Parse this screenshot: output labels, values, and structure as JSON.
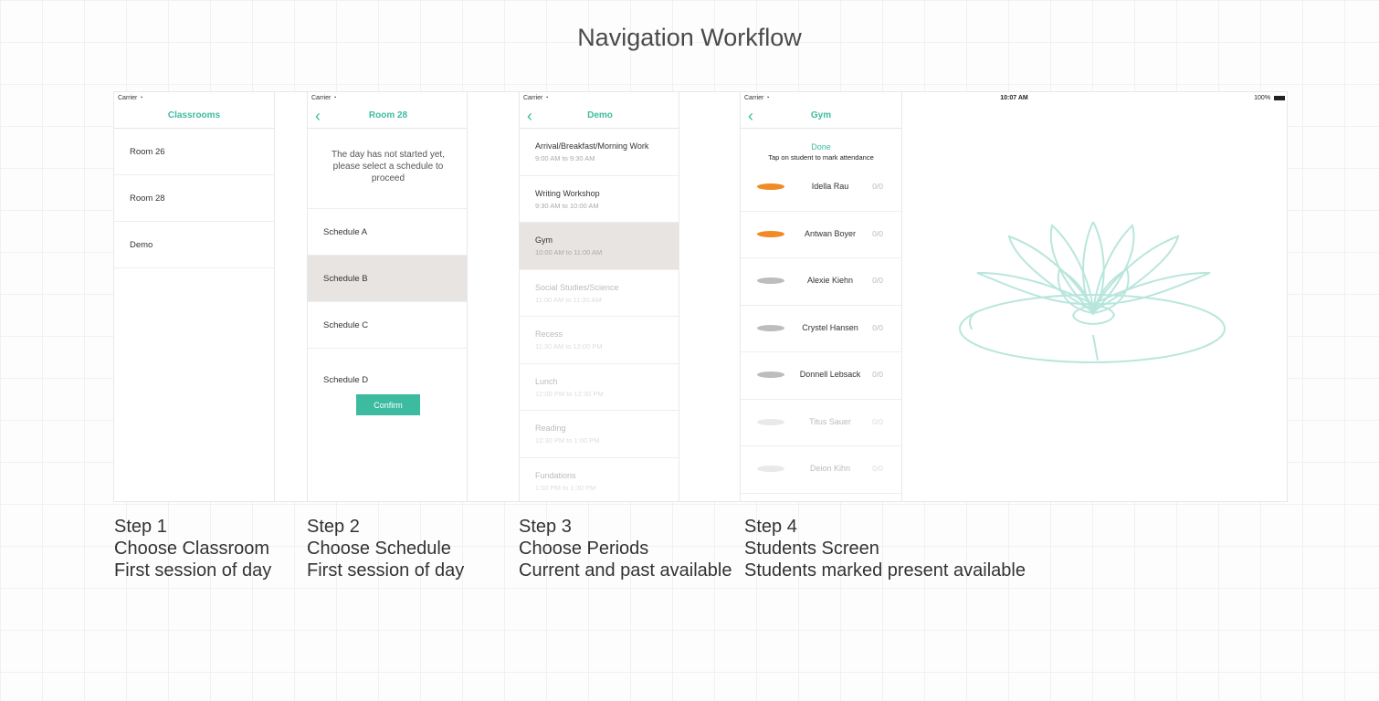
{
  "title": "Navigation Workflow",
  "colors": {
    "accent": "#3dbba0",
    "present": "#f18a24",
    "selected_row": "#e8e4e2"
  },
  "status": {
    "carrier": "Carrier",
    "time": "10:07 AM",
    "battery": "100%"
  },
  "step1": {
    "nav_title": "Classrooms",
    "rooms": [
      "Room 26",
      "Room 28",
      "Demo"
    ]
  },
  "step2": {
    "nav_title": "Room 28",
    "notice": "The day has not started yet, please select a schedule to proceed",
    "schedules": [
      "Schedule A",
      "Schedule B",
      "Schedule C",
      "Schedule D"
    ],
    "selected": "Schedule B",
    "confirm_label": "Confirm"
  },
  "step3": {
    "nav_title": "Demo",
    "periods": [
      {
        "name": "Arrival/Breakfast/Morning Work",
        "time": "9:00 AM to 9:30 AM",
        "state": "past"
      },
      {
        "name": "Writing Workshop",
        "time": "9:30 AM to 10:00 AM",
        "state": "past"
      },
      {
        "name": "Gym",
        "time": "10:00 AM to 11:00 AM",
        "state": "current"
      },
      {
        "name": "Social Studies/Science",
        "time": "11:00 AM to 11:30 AM",
        "state": "future"
      },
      {
        "name": "Recess",
        "time": "11:30 AM to 12:00 PM",
        "state": "future"
      },
      {
        "name": "Lunch",
        "time": "12:00 PM to 12:30 PM",
        "state": "future"
      },
      {
        "name": "Reading",
        "time": "12:30 PM to 1:00 PM",
        "state": "future"
      },
      {
        "name": "Fundations",
        "time": "1:00 PM to 1:30 PM",
        "state": "future"
      }
    ]
  },
  "step4": {
    "nav_title": "Gym",
    "done_label": "Done",
    "hint": "Tap on student to mark attendance",
    "students": [
      {
        "name": "Idella Rau",
        "score": "0/0",
        "status": "present"
      },
      {
        "name": "Antwan Boyer",
        "score": "0/0",
        "status": "present"
      },
      {
        "name": "Alexie Kiehn",
        "score": "0/0",
        "status": "absent"
      },
      {
        "name": "Crystel Hansen",
        "score": "0/0",
        "status": "absent"
      },
      {
        "name": "Donnell Lebsack",
        "score": "0/0",
        "status": "absent"
      },
      {
        "name": "Titus Sauer",
        "score": "0/0",
        "status": "unavailable"
      },
      {
        "name": "Deion Kihn",
        "score": "0/0",
        "status": "unavailable"
      }
    ]
  },
  "captions": [
    {
      "step": "Step 1",
      "title": "Choose Classroom",
      "note": "First session of day"
    },
    {
      "step": "Step 2",
      "title": "Choose Schedule",
      "note": "First session of day"
    },
    {
      "step": "Step 3",
      "title": "Choose Periods",
      "note": "Current and past available"
    },
    {
      "step": "Step 4",
      "title": "Students Screen",
      "note": "Students marked present available"
    }
  ]
}
